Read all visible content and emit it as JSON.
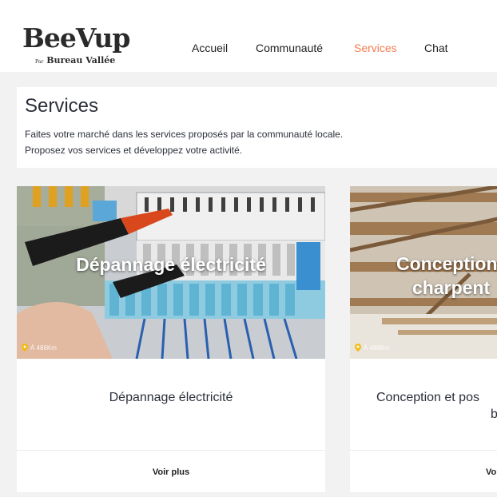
{
  "header": {
    "logo_main": "BeeVup",
    "logo_par": "Par",
    "logo_brand": "Bureau Vallée",
    "nav": [
      {
        "label": "Accueil",
        "active": false
      },
      {
        "label": "Communauté",
        "active": false
      },
      {
        "label": "Services",
        "active": true
      },
      {
        "label": "Chat",
        "active": false
      }
    ]
  },
  "intro": {
    "title": "Services",
    "line1": "Faites votre marché dans les services proposés par la communauté locale.",
    "line2": "Proposez vos services et développez votre activité."
  },
  "services": [
    {
      "image_title": "Dépannage électricité",
      "distance": "À 486Km",
      "name": "Dépannage électricité",
      "action": "Voir plus"
    },
    {
      "image_title_line1": "Conception",
      "image_title_line2": "charpent",
      "distance": "À 486Km",
      "name_line1": "Conception et pos",
      "name_line2": "b",
      "action": "Vo"
    }
  ],
  "colors": {
    "accent": "#f47c4f",
    "text": "#2b2f3a",
    "background": "#f2f2f3"
  }
}
